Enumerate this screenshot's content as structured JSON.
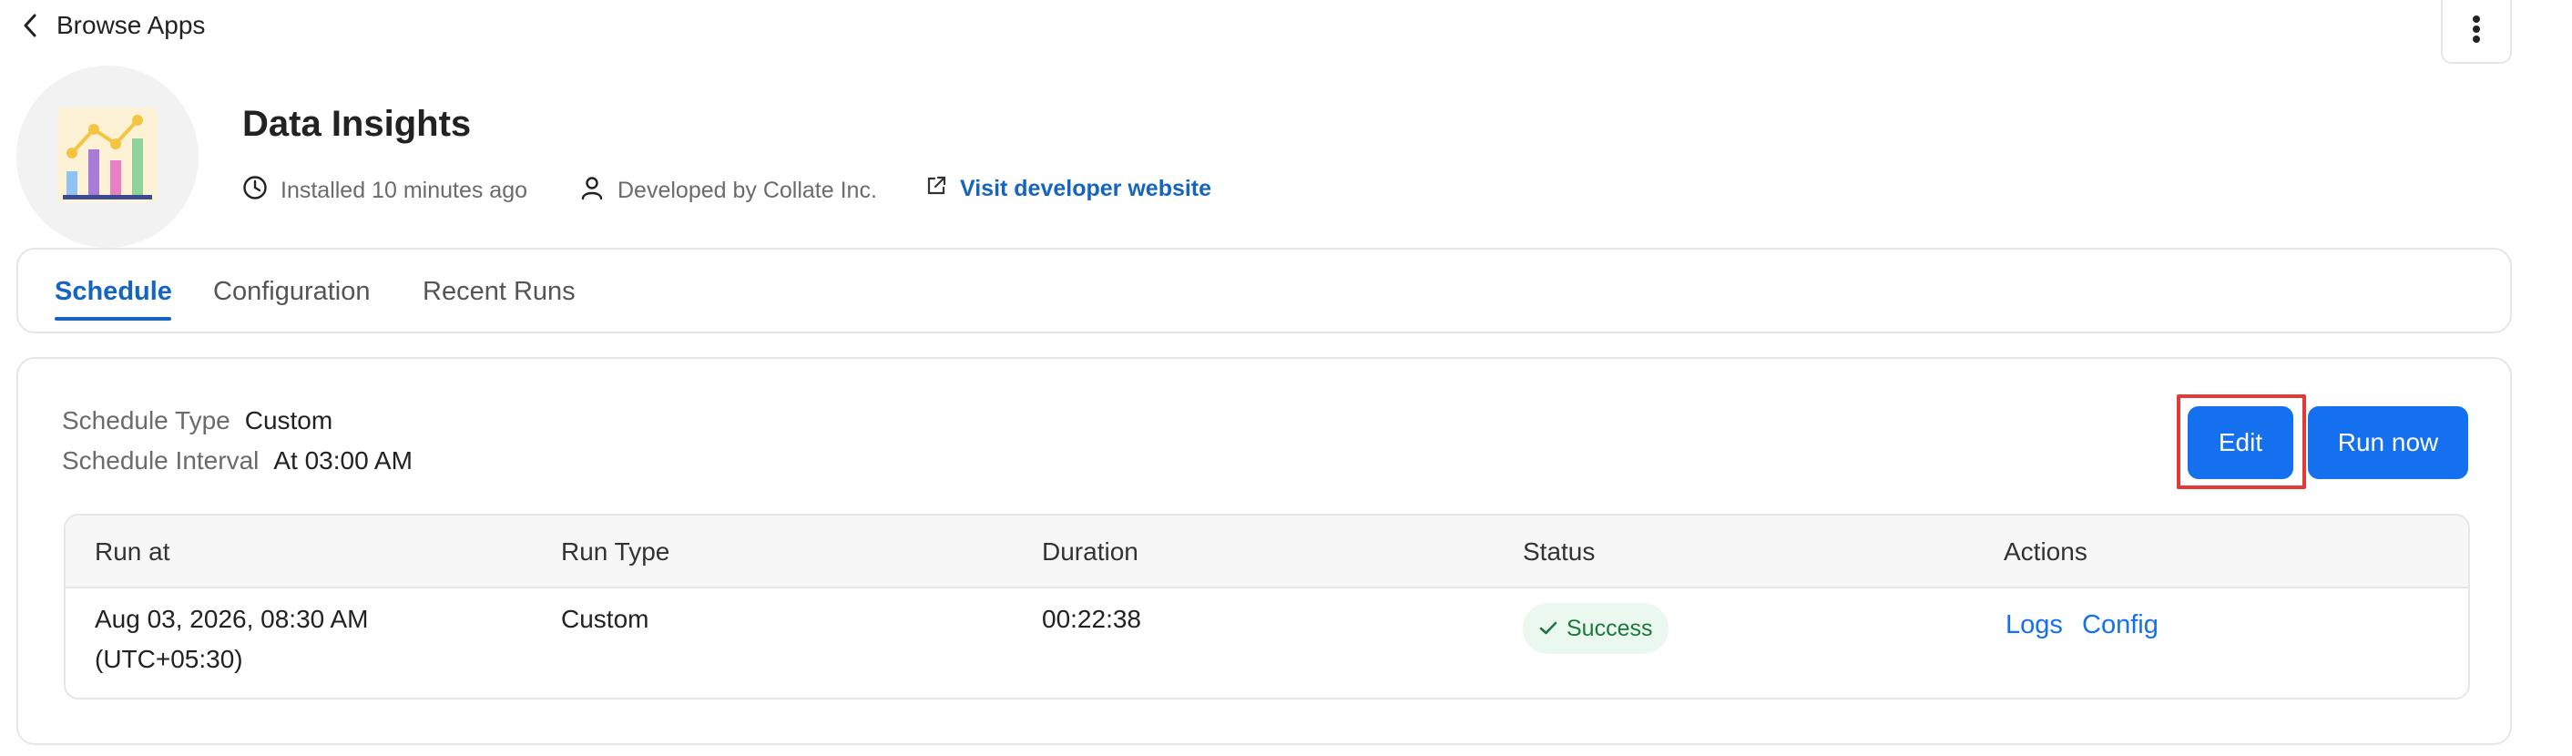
{
  "topbar": {
    "back_label": "Browse Apps"
  },
  "app": {
    "title": "Data Insights",
    "installed": "Installed 10 minutes ago",
    "developer": "Developed by Collate Inc.",
    "website_link": "Visit developer website"
  },
  "tabs": [
    {
      "label": "Schedule",
      "active": true
    },
    {
      "label": "Configuration",
      "active": false
    },
    {
      "label": "Recent Runs",
      "active": false
    }
  ],
  "schedule": {
    "type_label": "Schedule Type",
    "type_value": "Custom",
    "interval_label": "Schedule Interval",
    "interval_value": "At 03:00 AM",
    "edit_label": "Edit",
    "run_now_label": "Run now"
  },
  "runs_table": {
    "columns": [
      "Run at",
      "Run Type",
      "Duration",
      "Status",
      "Actions"
    ],
    "rows": [
      {
        "run_at_line1": "Aug 03, 2026, 08:30 AM",
        "run_at_line2": "(UTC+05:30)",
        "run_type": "Custom",
        "duration": "00:22:38",
        "status": "Success",
        "actions": [
          "Logs",
          "Config"
        ]
      }
    ]
  },
  "colors": {
    "primary": "#1570ef",
    "link": "#1565c0",
    "success_bg": "#ebf8ef",
    "success_text": "#1b7a3a",
    "highlight": "#e53935"
  },
  "icons": {
    "back": "chevron-left-icon",
    "more": "more-vertical-icon",
    "installed": "clock-icon",
    "developer": "user-icon",
    "website": "external-link-icon",
    "status": "check-icon"
  }
}
